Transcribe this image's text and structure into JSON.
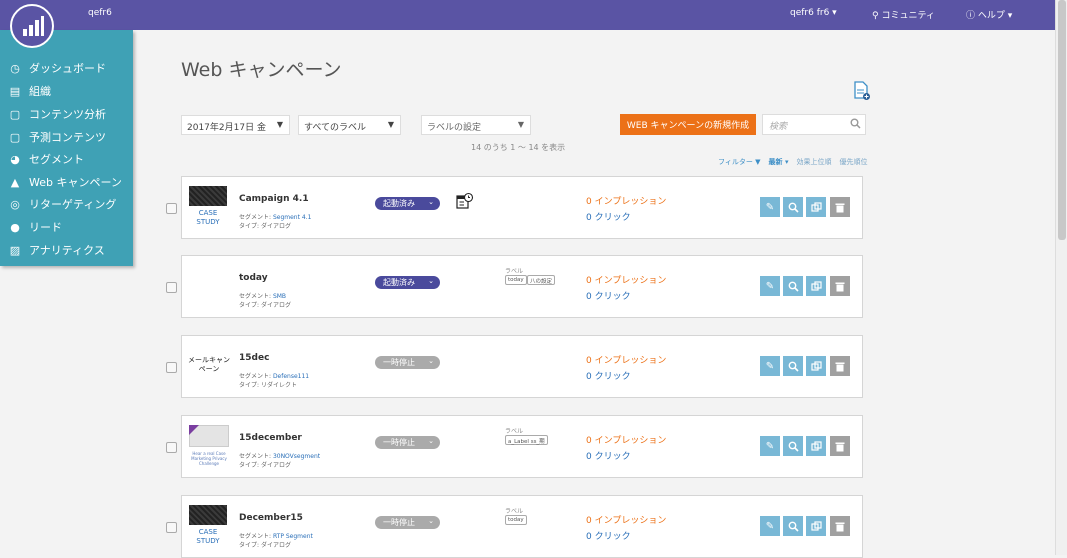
{
  "topbar": {
    "user": "qefr6",
    "account_menu": "qefr6 fr6 ▾",
    "community": "コミュニティ",
    "help": "ヘルプ ▾"
  },
  "sidebar": {
    "items": [
      {
        "label": "ダッシュボード",
        "icon": "dashboard-icon"
      },
      {
        "label": "組織",
        "icon": "briefcase-icon"
      },
      {
        "label": "コンテンツ分析",
        "icon": "document-icon"
      },
      {
        "label": "予測コンテンツ",
        "icon": "document-icon"
      },
      {
        "label": "セグメント",
        "icon": "pie-chart-icon"
      },
      {
        "label": "Web キャンペーン",
        "icon": "rocket-icon"
      },
      {
        "label": "リターゲティング",
        "icon": "retarget-icon"
      },
      {
        "label": "リード",
        "icon": "person-icon"
      },
      {
        "label": "アナリティクス",
        "icon": "chart-icon"
      }
    ]
  },
  "page": {
    "title": "Web キャンペーン",
    "date_select": "2017年2月17日 金",
    "label_filter": "すべてのラベル",
    "label_settings": "ラベルの設定",
    "new_button": "WEB キャンペーンの新規作成",
    "search_placeholder": "検索",
    "count": "14 のうち 1 ～ 14 を表示",
    "filter_label": "フィルター",
    "sort_latest": "最新",
    "sort_effect": "効果上位順",
    "sort_priority": "優先順位"
  },
  "common": {
    "segment_prefix": "セグメント: ",
    "type_prefix": "タイプ: ",
    "label_header": "ラベル",
    "case_study": "CASE STUDY"
  },
  "campaigns": [
    {
      "name": "Campaign 4.1",
      "segment": "Segment 4.1",
      "type": "ダイアログ",
      "status": "起動済み",
      "impressions": "0 インプレッション",
      "clicks": "0 クリック",
      "labels": []
    },
    {
      "name": "today",
      "segment": "SMB",
      "type": "ダイアログ",
      "status": "起動済み",
      "impressions": "0 インプレッション",
      "clicks": "0 クリック",
      "labels": [
        "today",
        "八の設定"
      ]
    },
    {
      "name": "15dec",
      "segment": "Defense111",
      "type": "リダイレクト",
      "status": "一時停止",
      "impressions": "0 インプレッション",
      "clicks": "0 クリック",
      "labels": [],
      "thumb_text": "メールキャンペーン"
    },
    {
      "name": "15december",
      "segment": "30NOVsegment",
      "type": "ダイアログ",
      "status": "一時停止",
      "impressions": "0 インプレッション",
      "clicks": "0 クリック",
      "labels": [
        "a_Label ss_期"
      ],
      "thumb_text": "Hear a real Case Marketing Privacy Challenge"
    },
    {
      "name": "December15",
      "segment": "RTP Segment",
      "type": "ダイアログ",
      "status": "一時停止",
      "impressions": "0 インプレッション",
      "clicks": "0 クリック",
      "labels": [
        "today"
      ]
    }
  ],
  "colors": {
    "topbar": "#5a54a4",
    "sidebar": "#3fa1b5",
    "accent": "#ec7117",
    "link": "#2a6fb8"
  }
}
